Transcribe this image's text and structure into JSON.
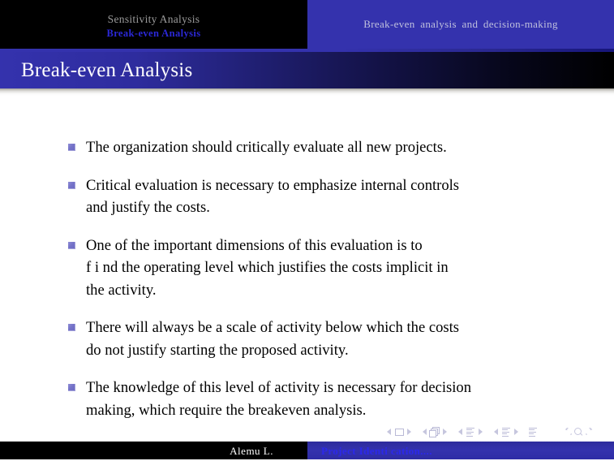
{
  "navbar": {
    "left_section": {
      "line1": "Sensitivity Analysis",
      "line2": "Break-even  Analysis"
    },
    "right_section": {
      "label": "Break-even  analysis  and  decision-making"
    }
  },
  "title_bar": {
    "title": "Break-even Analysis"
  },
  "slide": {
    "bullets": [
      {
        "text": "The organization should critically evaluate all new projects."
      },
      {
        "text": "Critical evaluation is necessary to emphasize internal controls\nand justify the costs."
      },
      {
        "text": "One of the important dimensions of this evaluation is to\nf i nd the operating level which justifies the costs implicit in\nthe activity."
      },
      {
        "text": "There will always be a scale of activity below which the costs\ndo not justify starting the proposed activity."
      },
      {
        "text": "The knowledge of this level of activity is necessary for decision\nmaking, which require the breakeven analysis."
      }
    ]
  },
  "nav_symbols": {
    "items": [
      {
        "icon": "frame-icon",
        "label": "frame navigation"
      },
      {
        "icon": "stacked-frames-icon",
        "label": "subsection frames navigation"
      },
      {
        "icon": "subsection-lines-icon",
        "label": "subsection navigation"
      },
      {
        "icon": "section-lines-icon",
        "label": "section navigation"
      },
      {
        "icon": "document-lines-icon",
        "label": "document navigation"
      }
    ],
    "tail": [
      {
        "icon": "back-arrow-icon",
        "label": "go back"
      },
      {
        "icon": "search-icon",
        "label": "search"
      },
      {
        "icon": "forward-arrow-icon",
        "label": "go forward"
      }
    ]
  },
  "footer": {
    "author": "Alemu L.",
    "document_title": "Project Identi cation...."
  },
  "colors": {
    "brand_blue": "#3432ad",
    "bullet_purple": "#7573c8",
    "navbar_inactive_text": "#9b9b9b",
    "navbar_active_text": "#2b28d8",
    "navbar_right_text": "#bfc0dd",
    "title_text": "#ffffff",
    "body_text": "#000000",
    "footer_title_text": "#2b28ea",
    "nav_symbol": "#c6c6de"
  }
}
